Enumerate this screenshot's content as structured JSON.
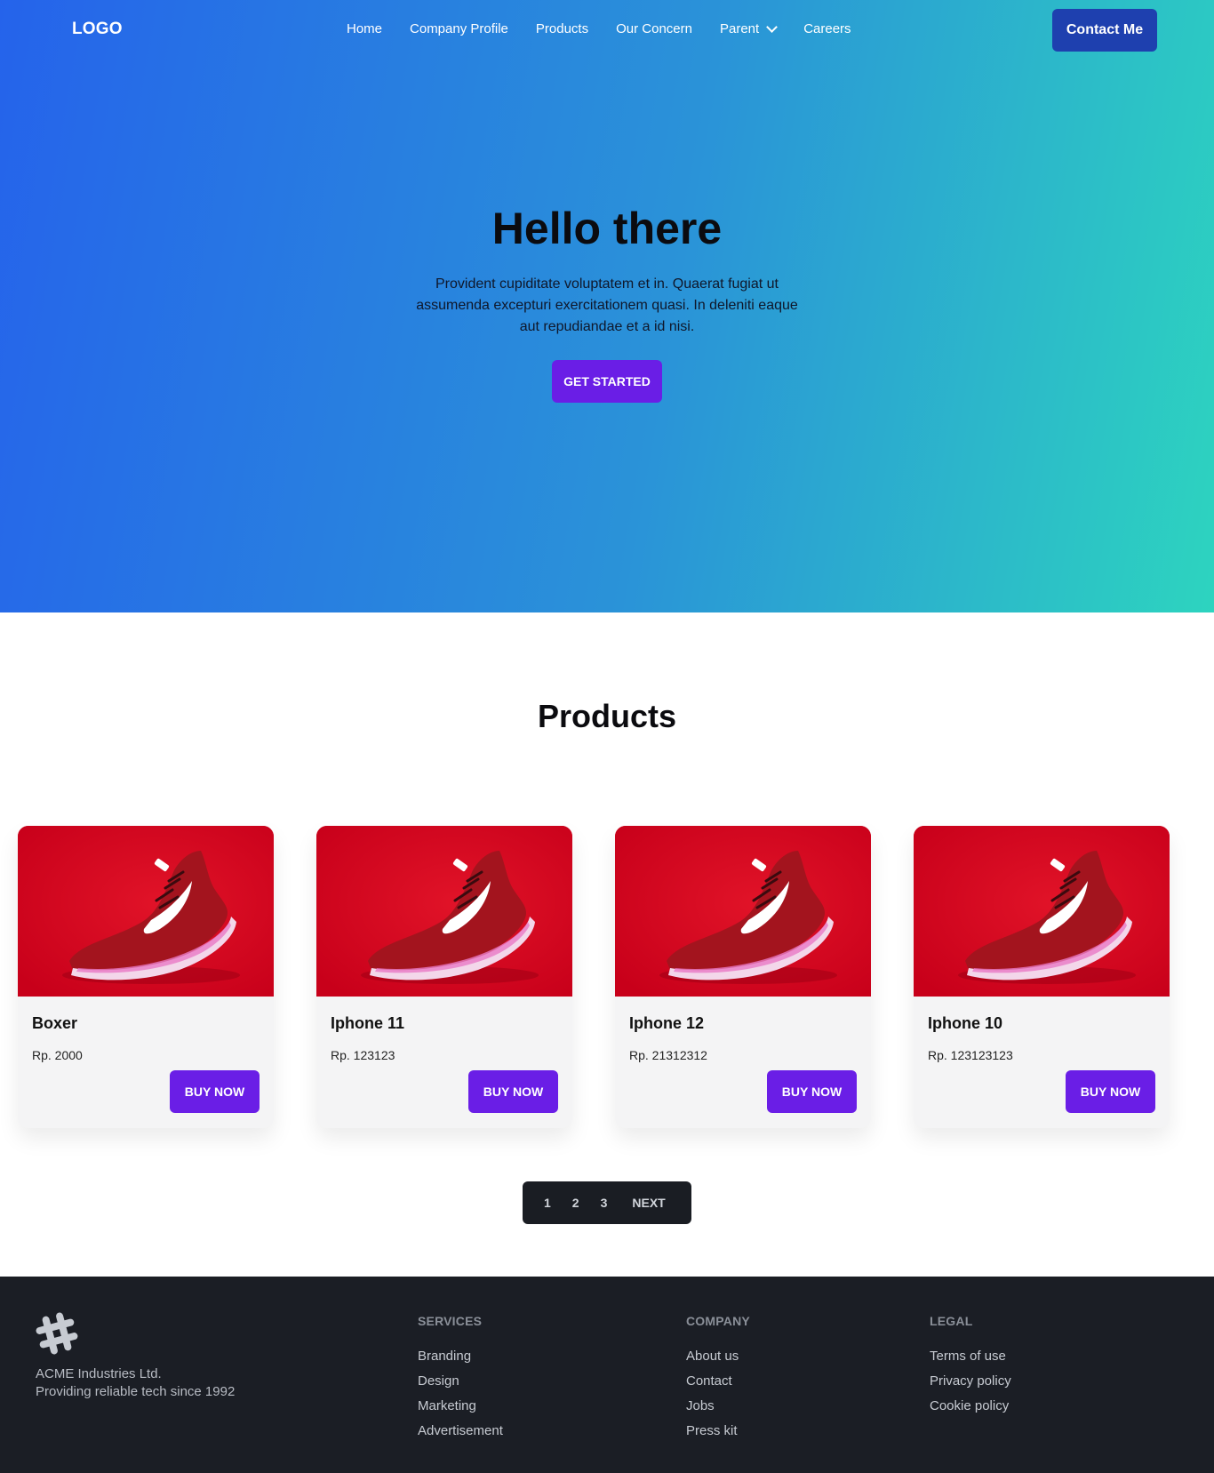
{
  "nav": {
    "logo": "LOGO",
    "links": [
      "Home",
      "Company Profile",
      "Products",
      "Our Concern",
      "Parent",
      "Careers"
    ],
    "contact_label": "Contact Me"
  },
  "hero": {
    "title": "Hello there",
    "text": "Provident cupiditate voluptatem et in. Quaerat fugiat ut assumenda excepturi exercitationem quasi. In deleniti eaque aut repudiandae et a id nisi.",
    "cta_label": "GET STARTED"
  },
  "products": {
    "title": "Products",
    "items": [
      {
        "name": "Boxer",
        "price": "Rp. 2000",
        "button": "BUY NOW"
      },
      {
        "name": "Iphone 11",
        "price": "Rp. 123123",
        "button": "BUY NOW"
      },
      {
        "name": "Iphone 12",
        "price": "Rp. 21312312",
        "button": "BUY NOW"
      },
      {
        "name": "Iphone 10",
        "price": "Rp. 123123123",
        "button": "BUY NOW"
      }
    ]
  },
  "pagination": {
    "pages": [
      "1",
      "2",
      "3"
    ],
    "next": "NEXT"
  },
  "footer": {
    "company_name": "ACME Industries Ltd.",
    "tagline": "Providing reliable tech since 1992",
    "services": {
      "heading": "SERVICES",
      "links": [
        "Branding",
        "Design",
        "Marketing",
        "Advertisement"
      ]
    },
    "company": {
      "heading": "COMPANY",
      "links": [
        "About us",
        "Contact",
        "Jobs",
        "Press kit"
      ]
    },
    "legal": {
      "heading": "LEGAL",
      "links": [
        "Terms of use",
        "Privacy policy",
        "Cookie policy"
      ]
    }
  },
  "colors": {
    "hero_gradient_start": "#2563eb",
    "hero_gradient_end": "#2dd4bf",
    "accent": "#6a1ee6",
    "contact_button": "#1e40af",
    "footer_bg": "#1b1e25"
  }
}
